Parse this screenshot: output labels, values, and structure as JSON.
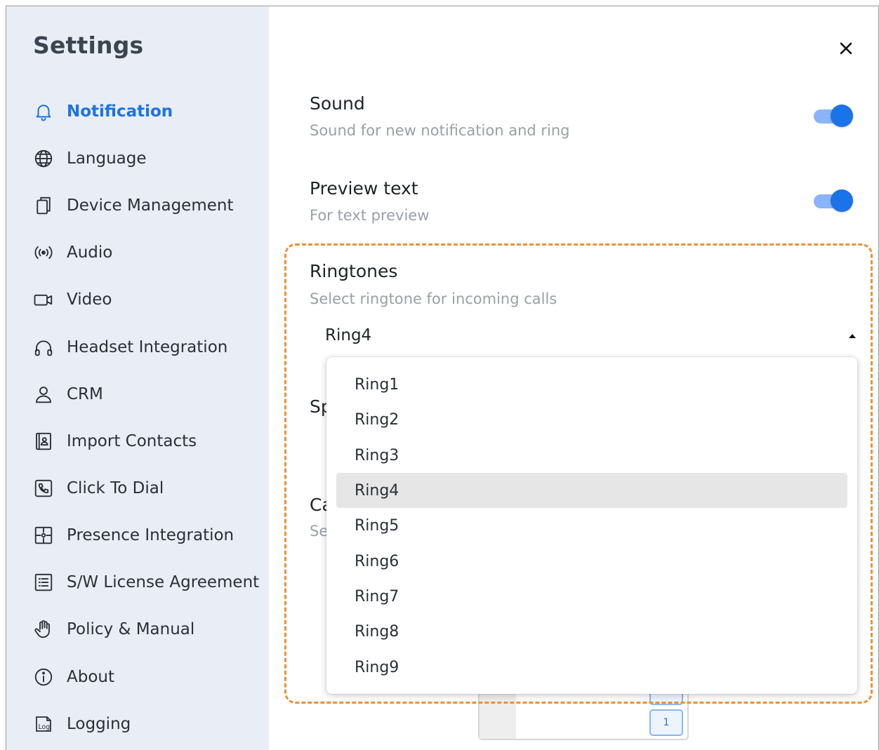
{
  "sidebar": {
    "title": "Settings",
    "items": [
      {
        "label": "Notification",
        "icon": "bell-icon",
        "active": true
      },
      {
        "label": "Language",
        "icon": "globe-icon"
      },
      {
        "label": "Device Management",
        "icon": "devices-icon"
      },
      {
        "label": "Audio",
        "icon": "audio-icon"
      },
      {
        "label": "Video",
        "icon": "video-camera-icon"
      },
      {
        "label": "Headset Integration",
        "icon": "headset-icon"
      },
      {
        "label": "CRM",
        "icon": "person-icon"
      },
      {
        "label": "Import Contacts",
        "icon": "contact-card-icon"
      },
      {
        "label": "Click To Dial",
        "icon": "phone-icon"
      },
      {
        "label": "Presence Integration",
        "icon": "puzzle-icon"
      },
      {
        "label": "S/W License Agreement",
        "icon": "list-document-icon"
      },
      {
        "label": "Policy & Manual",
        "icon": "hand-icon"
      },
      {
        "label": "About",
        "icon": "info-icon"
      },
      {
        "label": "Logging",
        "icon": "log-icon"
      }
    ]
  },
  "main": {
    "close_label": "✕",
    "sound": {
      "title": "Sound",
      "description": "Sound for new notification and ring",
      "enabled": true
    },
    "preview": {
      "title": "Preview text",
      "description": "For text preview",
      "enabled": true
    },
    "ringtones": {
      "title": "Ringtones",
      "description": "Select ringtone for incoming calls",
      "selected": "Ring4",
      "options": [
        "Ring1",
        "Ring2",
        "Ring3",
        "Ring4",
        "Ring5",
        "Ring6",
        "Ring7",
        "Ring8",
        "Ring9"
      ]
    },
    "obscured": {
      "sp": "Sp",
      "ca": "Ca",
      "se": "Se"
    },
    "page_number": "1"
  },
  "colors": {
    "accent": "#1a73e8",
    "highlight": "#e8923a",
    "sidebar_bg": "#e9eef6"
  }
}
